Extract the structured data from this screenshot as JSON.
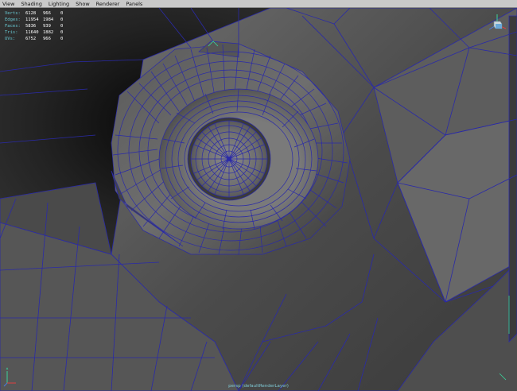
{
  "menubar": {
    "items": [
      "View",
      "Shading",
      "Lighting",
      "Show",
      "Renderer",
      "Panels"
    ]
  },
  "hud": {
    "rows": [
      {
        "label": "Verts:",
        "values": [
          "6128",
          "966",
          "0"
        ]
      },
      {
        "label": "Edges:",
        "values": [
          "11954",
          "1984",
          "0"
        ]
      },
      {
        "label": "Faces:",
        "values": [
          "5836",
          "939",
          "0"
        ]
      },
      {
        "label": "Tris:",
        "values": [
          "11640",
          "1882",
          "0"
        ]
      },
      {
        "label": "UVs:",
        "values": [
          "6752",
          "966",
          "0"
        ]
      }
    ]
  },
  "camera_label": "persp (defaultRenderLayer)",
  "icons": [
    "view-cube-icon",
    "axis-gizmo-icon"
  ],
  "colors": {
    "menubar_bg": "#c9c9c9",
    "viewport_bg": "#2b2b2b",
    "wire": "#2a2aa8",
    "hud_label": "#67c6d0",
    "hud_value": "#ffffff"
  }
}
